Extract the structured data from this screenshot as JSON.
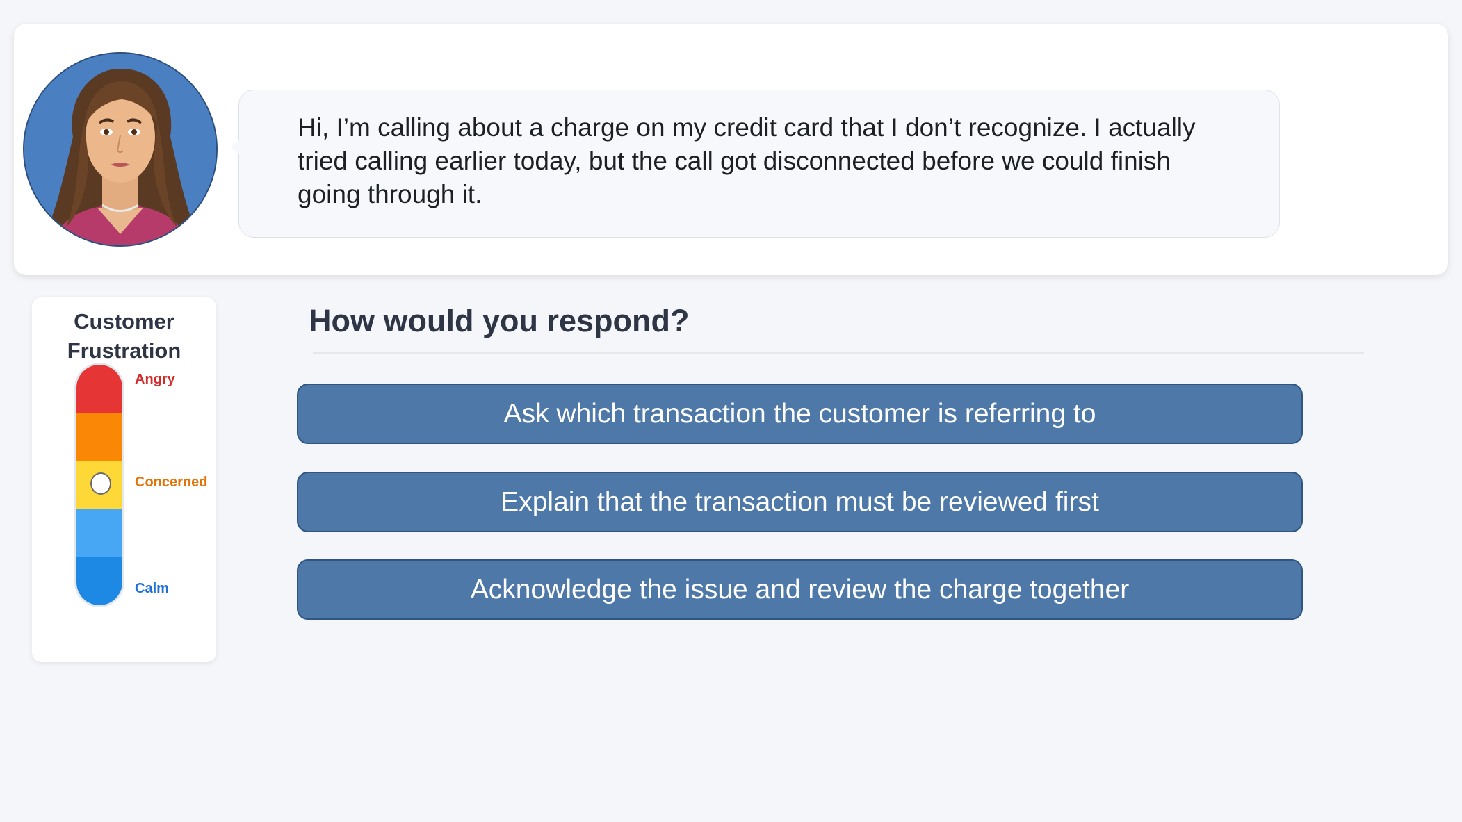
{
  "customer": {
    "avatar_icon": "customer-avatar",
    "message": "Hi, I’m calling about a charge on my credit card that I don’t recognize. I actually tried calling earlier today, but the call got disconnected before we could finish going through it."
  },
  "frustration_meter": {
    "title": "Customer Frustration",
    "labels": {
      "top": "Angry",
      "middle": "Concerned",
      "bottom": "Calm"
    },
    "current_level": "Concerned",
    "colors": [
      "#e63535",
      "#fb8707",
      "#fdd836",
      "#47a7f5",
      "#1e88e5"
    ]
  },
  "prompt": {
    "question": "How would you respond?"
  },
  "options": [
    {
      "label": "Ask which transaction the customer is referring to"
    },
    {
      "label": "Explain that the transaction must be reviewed first"
    },
    {
      "label": "Acknowledge the issue and review the charge together"
    }
  ],
  "theme": {
    "button_color": "#4e78a8",
    "background": "#f4f6fa"
  }
}
